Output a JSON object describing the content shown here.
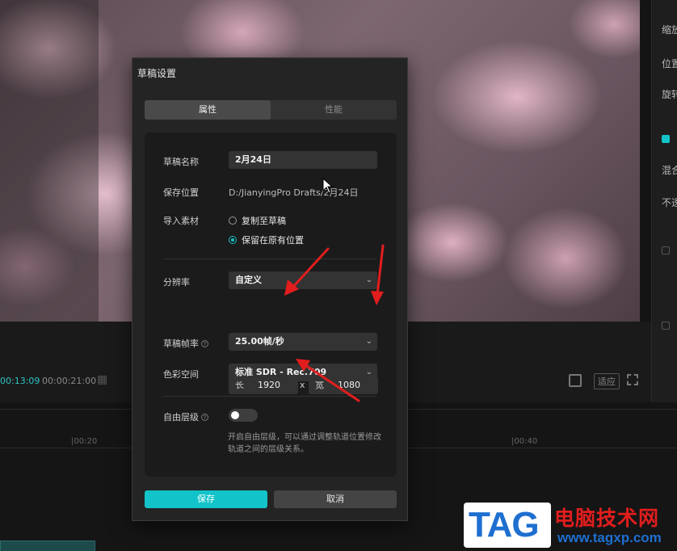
{
  "right_panel": {
    "labels": [
      "缩放",
      "位置",
      "旋转",
      "混合",
      "不透"
    ],
    "checked_label": "混"
  },
  "player": {
    "current_time": "00:13:09",
    "total_time": "00:00:21:00",
    "ratio_label": "适应"
  },
  "timeline": {
    "ticks": [
      "|00:20",
      "|00:40"
    ]
  },
  "dialog": {
    "title": "草稿设置",
    "tabs": [
      {
        "label": "属性",
        "active": true
      },
      {
        "label": "性能",
        "active": false
      }
    ],
    "fields": {
      "name_label": "草稿名称",
      "name_value": "2月24日",
      "path_label": "保存位置",
      "path_value": "D:/JianyingPro Drafts/2月24日",
      "import_label": "导入素材",
      "import_options": [
        {
          "label": "复制至草稿",
          "selected": false
        },
        {
          "label": "保留在原有位置",
          "selected": true
        }
      ],
      "resolution_label": "分辨率",
      "resolution_value": "自定义",
      "width_key": "长",
      "width_value": "1920",
      "dim_separator": "x",
      "height_key": "宽",
      "height_value": "1080",
      "framerate_label": "草稿帧率",
      "framerate_value": "25.00帧/秒",
      "colorspace_label": "色彩空间",
      "colorspace_value": "标准 SDR - Rec.709",
      "layer_label": "自由层级",
      "layer_enabled": false,
      "layer_desc": "开启自由层级，可以通过调整轨道位置修改轨道之间的层级关系。"
    },
    "buttons": {
      "save": "保存",
      "cancel": "取消"
    }
  },
  "watermark": {
    "tag": "TAG",
    "site_name": "电脑技术网",
    "url": "www.tagxp.com"
  },
  "colors": {
    "accent": "#12c4c9",
    "annotation_arrow": "#e21d1d",
    "watermark_blue": "#1e6fd0"
  }
}
